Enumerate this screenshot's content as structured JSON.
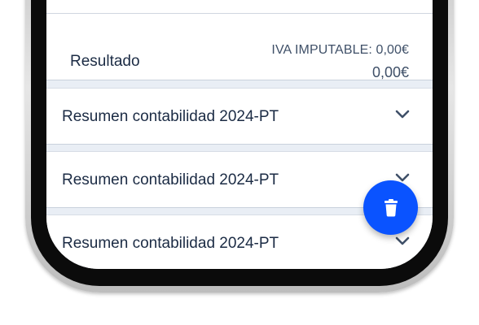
{
  "result": {
    "label": "Resultado",
    "iva_imputable": "IVA IMPUTABLE: 0,00€",
    "total": "0,00€"
  },
  "sections": [
    {
      "title": "Resumen contabilidad 2024-PT"
    },
    {
      "title": "Resumen contabilidad 2024-PT"
    },
    {
      "title": "Resumen contabilidad 2024-PT"
    }
  ],
  "icons": {
    "chevron": "chevron-down-icon",
    "fab": "trash-icon"
  },
  "colors": {
    "accent": "#0a53ff",
    "text": "#1b2b44",
    "muted_text": "#3f5068",
    "screen_bg": "#e9eef5"
  }
}
